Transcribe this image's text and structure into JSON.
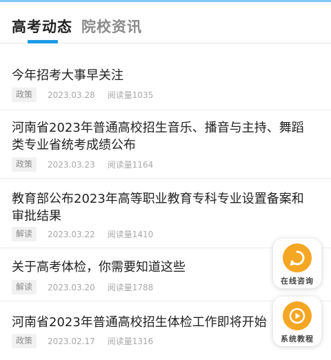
{
  "tabs": [
    {
      "label": "高考动态",
      "active": true
    },
    {
      "label": "院校资讯",
      "active": false
    }
  ],
  "news": [
    {
      "title": "今年招考大事早关注",
      "tag": "政策",
      "date": "2023.03.28",
      "views": "阅读量1035"
    },
    {
      "title": "河南省2023年普通高校招生音乐、播音与主持、舞蹈类专业省统考成绩公布",
      "tag": "政策",
      "date": "2023.03.23",
      "views": "阅读量1164"
    },
    {
      "title": "教育部公布2023年高等职业教育专科专业设置备案和审批结果",
      "tag": "解读",
      "date": "2023.03.22",
      "views": "阅读量1410"
    },
    {
      "title": "关于高考体检，你需要知道这些",
      "tag": "解读",
      "date": "2023.03.20",
      "views": "阅读量1788"
    },
    {
      "title": "河南省2023年普通高校招生体检工作即将开始",
      "tag": "政策",
      "date": "2023.02.17",
      "views": "阅读量1316"
    }
  ],
  "floating": {
    "consult": {
      "label": "在线咨询",
      "icon": "chat-icon"
    },
    "tutorial": {
      "label": "系统教程",
      "icon": "play-icon"
    }
  },
  "colors": {
    "accent": "#1e9be6",
    "float": "#f5a623",
    "top_bar": "#7fc8f5"
  }
}
